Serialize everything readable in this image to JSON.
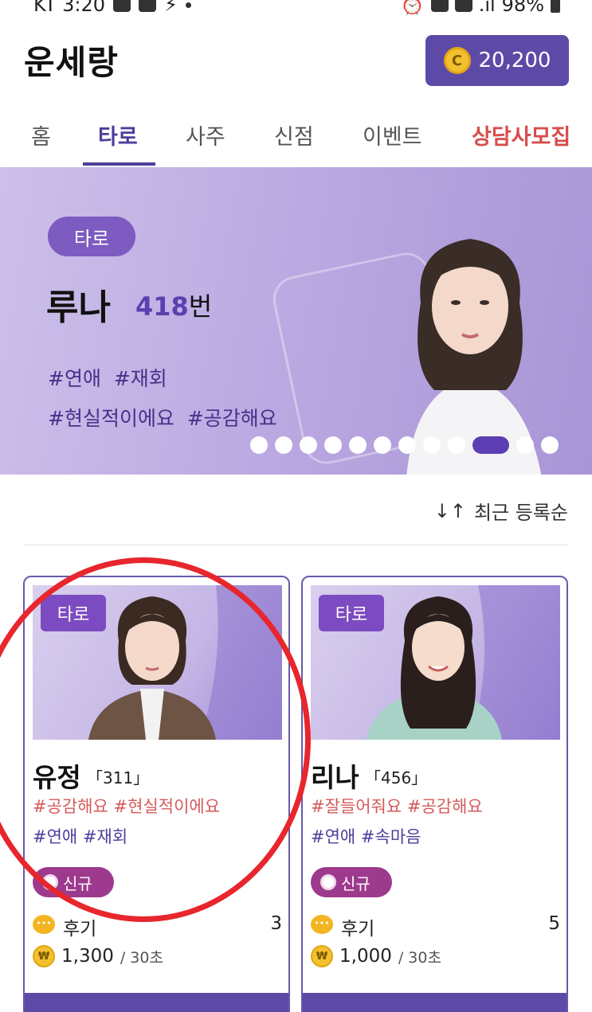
{
  "status_bar": {
    "carrier_time": "KT 3:20",
    "battery": "98%",
    "icons": [
      "talk-icon",
      "image-icon",
      "bolt-icon",
      "dot-icon",
      "alarm-icon",
      "hd-icon",
      "5g-icon",
      "signal-icon",
      "battery-icon"
    ]
  },
  "header": {
    "logo": "운세랑",
    "coin_balance": "20,200",
    "coin_icon_glyph": "C"
  },
  "tabs": [
    {
      "label": "홈"
    },
    {
      "label": "타로"
    },
    {
      "label": "사주"
    },
    {
      "label": "신점"
    },
    {
      "label": "이벤트"
    },
    {
      "label": "상담사모집"
    }
  ],
  "active_tab": "타로",
  "banner": {
    "tag": "타로",
    "name": "루나",
    "number": "418",
    "number_suffix": "번",
    "hashtags_line1": "#연애  #재회",
    "hashtags_line2": "#현실적이에요  #공감해요",
    "slide_count": 12,
    "active_slide": 10
  },
  "sort": {
    "icon": "sort-arrows-icon",
    "label": "최근 등록순"
  },
  "counselors": [
    {
      "tag": "타로",
      "name": "유정",
      "number": "「311」",
      "tags1": "#공감해요 #현실적이에요",
      "tags2": "#연애 #재회",
      "badge": "신규",
      "review_label": "후기",
      "review_count": "3",
      "price": "1,300",
      "price_unit": "/ 30초"
    },
    {
      "tag": "타로",
      "name": "리나",
      "number": "「456」",
      "tags1": "#잘들어줘요 #공감해요",
      "tags2": "#연애 #속마음",
      "badge": "신규",
      "review_label": "후기",
      "review_count": "5",
      "price": "1,000",
      "price_unit": "/ 30초"
    }
  ],
  "colors": {
    "brand_purple": "#5d4aa7",
    "tab_active": "#4e3e9b",
    "recruit_red": "#d94b4b",
    "annotation_red": "#e8262d"
  }
}
